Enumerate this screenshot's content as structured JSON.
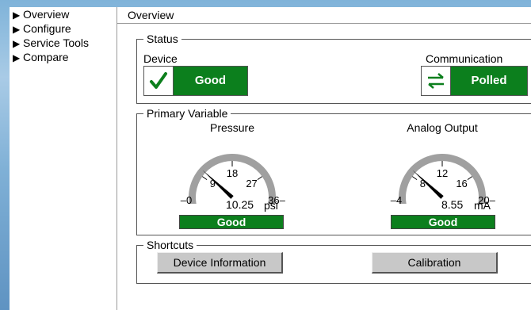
{
  "nav": {
    "items": [
      {
        "label": "Overview"
      },
      {
        "label": "Configure"
      },
      {
        "label": "Service Tools"
      },
      {
        "label": "Compare"
      }
    ]
  },
  "main": {
    "title": "Overview"
  },
  "status": {
    "legend": "Status",
    "device": {
      "label": "Device",
      "value": "Good",
      "icon": "checkmark-icon",
      "color": "#0c7f1d"
    },
    "communication": {
      "label": "Communication",
      "value": "Polled",
      "icon": "exchange-arrows-icon",
      "color": "#0c7f1d"
    }
  },
  "primary_variable": {
    "legend": "Primary Variable",
    "gauges": [
      {
        "title": "Pressure",
        "ticks": [
          "0",
          "9",
          "18",
          "27",
          "36"
        ],
        "min": 0,
        "max": 36,
        "value": 10.25,
        "value_text": "10.25",
        "unit": "psi",
        "status": "Good"
      },
      {
        "title": "Analog Output",
        "ticks": [
          "4",
          "8",
          "12",
          "16",
          "20"
        ],
        "min": 4,
        "max": 20,
        "value": 8.55,
        "value_text": "8.55",
        "unit": "mA",
        "status": "Good"
      }
    ]
  },
  "shortcuts": {
    "legend": "Shortcuts",
    "buttons": [
      {
        "label": "Device Information"
      },
      {
        "label": "Calibration"
      }
    ]
  }
}
